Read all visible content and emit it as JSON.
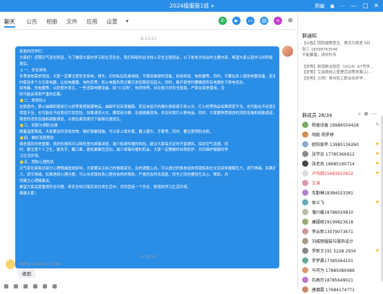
{
  "window": {
    "title": "2024级服装1班",
    "title_chevron": "▾",
    "right_controls": [
      "帮编",
      "▣",
      "⋯",
      "—",
      "□",
      "✕"
    ]
  },
  "tabs": [
    {
      "label": "聊天",
      "active": true
    },
    {
      "label": "公告",
      "active": false
    },
    {
      "label": "相册",
      "active": false
    },
    {
      "label": "文件",
      "active": false
    },
    {
      "label": "应用",
      "active": false
    },
    {
      "label": "设置",
      "active": false
    }
  ],
  "tabs_more": "▾",
  "toolbar_icons": [
    "phone-icon",
    "video-icon",
    "screen-share-icon",
    "document-icon",
    "add-icon",
    "more-icon"
  ],
  "chat": {
    "timestamp_1": "9:13:57",
    "timestamp_2": "9:18:13",
    "message_lines": [
      "亲爱的同学们：",
      "大家好！近期天气变化明显，为了确保大家的学习和生活安全，我们特组织此次线上安全主题班会，以下是本次班会的主要内容，希望大家认真学习并积极落实。",
      "💧一、安全用电",
      "冬季用电需求增加，大家一定要注意安全用电。首先，切勿私拉乱接电线，不使用被禁的设备，如电热毯、电热器等。同时，不要在床上使用电器设备，若发现电线破损等情况，要及时报告，以免引发事故。使用完毕后要及时断电。",
      "时使用多个大功率电器，比如电暖器、电吹风等，防止电路负荷过载引发短路甚至起火。同时，离开宿舍时要确保所有电器处于断电状态，",
      "如电脑、充电器等，以防意外发生。一些违禁电暖设备，如“小太阳”、热得快等，存在极大的安全隐患，严禁在宿舍使用，否",
      "则可能会带来严重的后果。",
      "🌟二、宿舍防火",
      "在宿舍内，禁止抽烟和使用打火机等易燃易爆物品。抽烟不仅有害健康，而且未熄灭的烟头很容易引发火灾。打火机等物品如果保管不当，也可能在不经意间引发危险。如果遇到火灾，要保持冷静，迅速拨打119报警电话，并用湿毛巾捂住口鼻，",
      "保管不当，也可能在不经意间引发危险。如果遇到火灾，要保持冷静，迅速撤离现场，并及时拨打火警电话。同时，大家要熟悉宿舍的消防设施和疏散通道，以便在紧急情况下能够迅速逃生。",
      "宿舍的消防设施和疏散通道，以便在紧急情况下能够迅速逃生。",
      "🌟三、回家与预防交通",
      "随着温度降低，大家要及时添加衣物，做好保暖措施。可以穿上厚外套，戴上围巾、手套等，同时，要注意预防冻疮。",
      "🌟四、做好流感预防",
      "宿舍通风非常重要。良好的通风可以降低室内病毒浓度，减少疾病传播的风险。建议大家每天定时开窗通风，保持空气流通。同",
      "时，要注意个人卫生，勤洗手，戴口罩，避免聚集性活动，减少病毒传播的机会。大家一定要做好自我防护，共同维护健康的学",
      "习生活环境。",
      "🌟五、预防心理危机",
      "天气变化容易对部分心理情绪造成影响，大家要关注自己的情绪变化，及时调整心态。可以通过积极参加体育锻炼和社交活动来缓解压力，调节情绪。如果遇到心理问题，可以寻求学校心理咨询中心的帮助，严重的及时去就医。同学之间也要相互关心、帮助，共",
      "力，调节情绪。如果遇到心理问题，可以寻求我校系心理咨询师的帮助，严重的及时去就医。同学之间也要相互关心、帮助，共",
      "同建立心理健康关。",
      "希望大家高度重视安全问题，将安全知识落实到日常生活中，共同营造一个安全、舒适的学习生活环境。",
      "谢谢大家！"
    ],
    "sender_name": "刘木刘 15585157139",
    "reply_text": "收到"
  },
  "sidebar": {
    "notice_title": "群通知",
    "notice_rows": [
      {
        "tag": "【公告】",
        "text": "团防越教室生、情况为宿舍 9日"
      },
      {
        "tag": "",
        "text": "张三 18398763546"
      },
      {
        "tag": "",
        "text": "不能暴露，请勿外传"
      },
      {
        "tag": "【文件】",
        "text": "新冠肺炎防控（2024）67号学..."
      },
      {
        "tag": "【文件】",
        "text": "艾滋病线上管理活动策划案(1)..."
      },
      {
        "tag": "【文件】",
        "text": "示例）贵州轻工职业技术学..."
      }
    ],
    "members_title": "群成员 28/34",
    "member_tool_icons": [
      "search-icon",
      "add-member-icon",
      "more-icon"
    ],
    "members": [
      {
        "name": "杨香张香 19984504428",
        "color": "#7a6",
        "red": false,
        "right_icon": "✎"
      },
      {
        "name": "明勒 杨罗婷",
        "color": "#cf8d54",
        "red": false,
        "right_icon": ""
      },
      {
        "name": "欧阳俊怀 13985136260",
        "color": "#8aa6cf",
        "red": false,
        "right_icon": "★"
      },
      {
        "name": "张学余 17785366912",
        "color": "#8c8c8c",
        "red": false,
        "right_icon": "★"
      },
      {
        "name": "张老南 18685190714",
        "color": "#444",
        "red": false,
        "right_icon": "★"
      },
      {
        "name": "卢玛杨15683910822",
        "color": "#ddd",
        "red": true,
        "right_icon": "★"
      },
      {
        "name": "王涛",
        "color": "#d9a",
        "red": true,
        "right_icon": ""
      },
      {
        "name": "车勤琳18384023381",
        "color": "#a8c",
        "red": false,
        "right_icon": ""
      },
      {
        "name": "侯义飞",
        "color": "#6ab",
        "red": false,
        "right_icon": "★"
      },
      {
        "name": "蒲兴媛18786029810",
        "color": "#bba",
        "red": false,
        "right_icon": ""
      },
      {
        "name": "康疆娅19199823618",
        "color": "#9a7",
        "red": false,
        "right_icon": ""
      },
      {
        "name": "李云新13079073671",
        "color": "#c99",
        "red": false,
        "right_icon": ""
      },
      {
        "name": "刘威丽服装与服饰设计",
        "color": "#a98",
        "red": false,
        "right_icon": ""
      },
      {
        "name": "罗新王191 5228 2934",
        "color": "#888",
        "red": false,
        "right_icon": "★"
      },
      {
        "name": "罗梦晨17385564101",
        "color": "#6a9",
        "red": false,
        "right_icon": ""
      },
      {
        "name": "马可为 17885080486",
        "color": "#d97",
        "red": false,
        "right_icon": ""
      },
      {
        "name": "石高玲18785649021",
        "color": "#b7c",
        "red": false,
        "right_icon": ""
      },
      {
        "name": "唐璐露 17684174771",
        "color": "#c86",
        "red": false,
        "right_icon": ""
      }
    ]
  },
  "colors": {
    "accent": "#2a8de6",
    "bubble": "#2a8de6",
    "red_name": "#e33333",
    "star": "#f5b41b"
  }
}
